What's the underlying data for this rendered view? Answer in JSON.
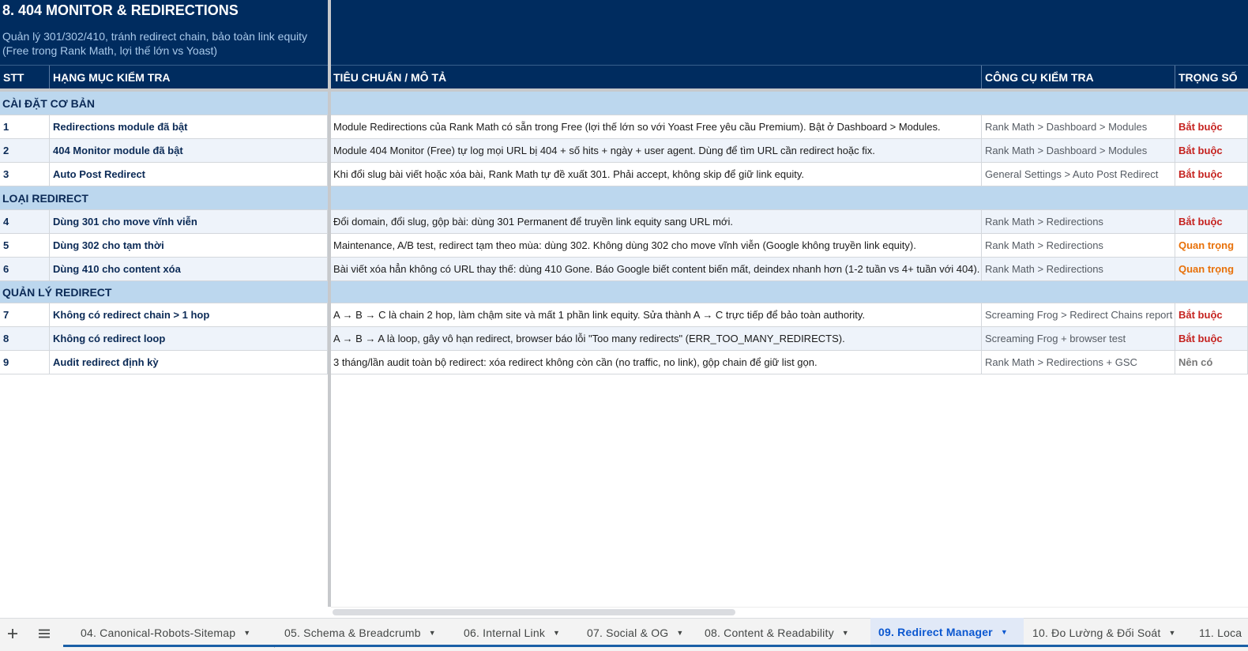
{
  "sheet": {
    "title": "8. 404 MONITOR & REDIRECTIONS",
    "subtitle_line1": "Quản lý 301/302/410, tránh redirect chain, bảo toàn link equity",
    "subtitle_line2": "(Free trong Rank Math, lợi thế lớn vs Yoast)"
  },
  "columns": {
    "stt": "STT",
    "item": "HẠNG MỤC KIỂM TRA",
    "desc": "TIÊU CHUẨN / MÔ TẢ",
    "tool": "CÔNG CỤ KIỂM TRA",
    "weight": "TRỌNG SỐ"
  },
  "sections": [
    {
      "label": "CÀI ĐẶT CƠ BẢN"
    },
    {
      "label": "LOẠI REDIRECT"
    },
    {
      "label": "QUẢN LÝ REDIRECT"
    }
  ],
  "rows": [
    {
      "stt": "1",
      "item": "Redirections module đã bật",
      "desc": "Module Redirections của Rank Math có sẵn trong Free (lợi thế lớn so với Yoast Free yêu cầu Premium). Bật ở Dashboard > Modules.",
      "tool": "Rank Math > Dashboard > Modules",
      "weight": "Bắt buộc"
    },
    {
      "stt": "2",
      "item": "404 Monitor module đã bật",
      "desc": "Module 404 Monitor (Free) tự log mọi URL bị 404 + số hits + ngày + user agent. Dùng để tìm URL cần redirect hoặc fix.",
      "tool": "Rank Math > Dashboard > Modules",
      "weight": "Bắt buộc"
    },
    {
      "stt": "3",
      "item": "Auto Post Redirect",
      "desc": "Khi đổi slug bài viết hoặc xóa bài, Rank Math tự đề xuất 301. Phải accept, không skip để giữ link equity.",
      "tool": "General Settings > Auto Post Redirect",
      "weight": "Bắt buộc"
    },
    {
      "stt": "4",
      "item": "Dùng 301 cho move vĩnh viễn",
      "desc": "Đổi domain, đổi slug, gộp bài: dùng 301 Permanent để truyền link equity sang URL mới.",
      "tool": "Rank Math > Redirections",
      "weight": "Bắt buộc"
    },
    {
      "stt": "5",
      "item": "Dùng 302 cho tạm thời",
      "desc": "Maintenance, A/B test, redirect tạm theo mùa: dùng 302. Không dùng 302 cho move vĩnh viễn (Google không truyền link equity).",
      "tool": "Rank Math > Redirections",
      "weight": "Quan trọng"
    },
    {
      "stt": "6",
      "item": "Dùng 410 cho content xóa",
      "desc": "Bài viết xóa hẳn không có URL thay thế: dùng 410 Gone. Báo Google biết content biến mất, deindex nhanh hơn (1-2 tuần vs 4+ tuần với 404).",
      "tool": "Rank Math > Redirections",
      "weight": "Quan trọng"
    },
    {
      "stt": "7",
      "item": "Không có redirect chain > 1 hop",
      "desc": "A → B → C là chain 2 hop, làm chậm site và mất 1 phần link equity. Sửa thành A → C trực tiếp để bảo toàn authority.",
      "tool": "Screaming Frog > Redirect Chains report",
      "weight": "Bắt buộc"
    },
    {
      "stt": "8",
      "item": "Không có redirect loop",
      "desc": "A → B → A là loop, gây vô hạn redirect, browser báo lỗi \"Too many redirects\" (ERR_TOO_MANY_REDIRECTS).",
      "tool": "Screaming Frog + browser test",
      "weight": "Bắt buộc"
    },
    {
      "stt": "9",
      "item": "Audit redirect định kỳ",
      "desc": "3 tháng/lần audit toàn bộ redirect: xóa redirect không còn cần (no traffic, no link), gộp chain để giữ list gọn.",
      "tool": "Rank Math > Redirections + GSC",
      "weight": "Nên có"
    }
  ],
  "weight_colors": {
    "Bắt buộc": "#c5221f",
    "Quan trọng": "#e8710a",
    "Nên có": "#777777"
  },
  "tabs": {
    "add_icon": "plus-icon",
    "list_icon": "hamburger-icon",
    "items": [
      {
        "label": "04. Canonical-Robots-Sitemap"
      },
      {
        "label": "05. Schema & Breadcrumb"
      },
      {
        "label": "06. Internal Link"
      },
      {
        "label": "07. Social & OG"
      },
      {
        "label": "08. Content & Readability"
      },
      {
        "label": "09. Redirect Manager"
      },
      {
        "label": "10. Đo Lường & Đối Soát"
      },
      {
        "label": "11. Loca"
      }
    ]
  }
}
